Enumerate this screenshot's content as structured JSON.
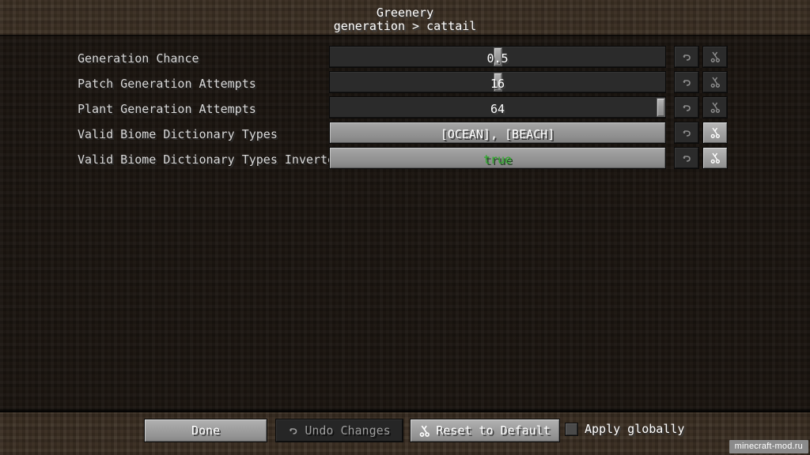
{
  "header": {
    "title": "Greenery",
    "breadcrumb": "generation > cattail"
  },
  "colors": {
    "header_dirt": "#3a2e22",
    "body_dirt": "#1b1510",
    "slider_track": "#2b2b2b",
    "light_button": "#9b9b9b",
    "text_primary": "#ffffff",
    "text_label": "#d8d8d8",
    "value_true_green": "#2aab27",
    "watermark_bg": "#8b8b8b"
  },
  "rows": [
    {
      "label": "Generation Chance",
      "type": "slider",
      "value": "0.5",
      "handle_percent": 50,
      "undo_icon": "undo-icon",
      "reset_icon": "reset-icon",
      "undo_enabled": false,
      "reset_highlighted": false
    },
    {
      "label": "Patch Generation Attempts",
      "type": "slider",
      "value": "16",
      "handle_percent": 50,
      "undo_icon": "undo-icon",
      "reset_icon": "reset-icon",
      "undo_enabled": false,
      "reset_highlighted": false
    },
    {
      "label": "Plant Generation Attempts",
      "type": "slider",
      "value": "64",
      "handle_percent": 100,
      "undo_icon": "undo-icon",
      "reset_icon": "reset-icon",
      "undo_enabled": false,
      "reset_highlighted": false
    },
    {
      "label": "Valid Biome Dictionary Types",
      "type": "textfield",
      "value": "[OCEAN], [BEACH]",
      "value_color": "white",
      "undo_icon": "undo-icon",
      "reset_icon": "reset-icon",
      "undo_enabled": false,
      "reset_highlighted": true
    },
    {
      "label": "Valid Biome Dictionary Types Inverted",
      "type": "textfield",
      "value": "true",
      "value_color": "green",
      "undo_icon": "undo-icon",
      "reset_icon": "reset-icon",
      "undo_enabled": false,
      "reset_highlighted": true
    }
  ],
  "footer": {
    "done_label": "Done",
    "undo_label": "Undo Changes",
    "undo_icon": "undo-icon",
    "reset_label": "Reset to Default",
    "reset_icon": "reset-icon",
    "apply_globally_label": "Apply globally",
    "apply_globally_checked": false
  },
  "watermark": {
    "text": "minecraft-mod.ru"
  }
}
